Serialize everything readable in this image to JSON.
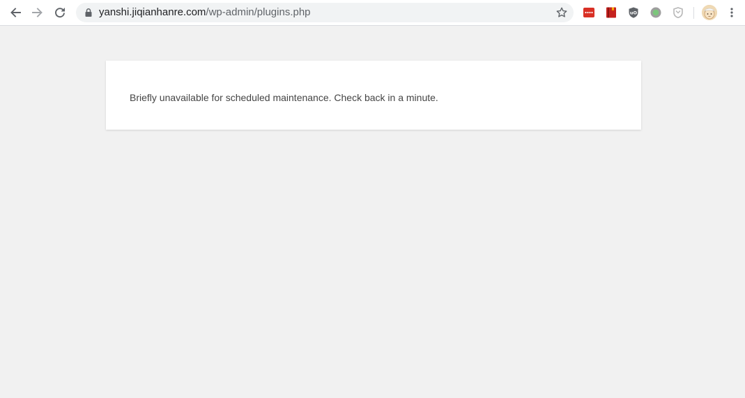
{
  "browser": {
    "address_bar": {
      "host": "yanshi.jiqianhanre.com",
      "path": "/wp-admin/plugins.php"
    },
    "nav_icons": [
      "back-arrow-icon",
      "forward-arrow-icon",
      "reload-icon"
    ],
    "extension_icons": [
      "red-dots-extension-icon",
      "red-book-extension-icon",
      "ublock-shield-icon",
      "green-circle-extension-icon",
      "grey-shield-extension-icon"
    ],
    "colors": {
      "toolbar_bg": "#ffffff",
      "omnibox_bg": "#f1f3f4",
      "page_bg": "#f1f1f1"
    }
  },
  "page": {
    "message": "Briefly unavailable for scheduled maintenance. Check back in a minute."
  }
}
